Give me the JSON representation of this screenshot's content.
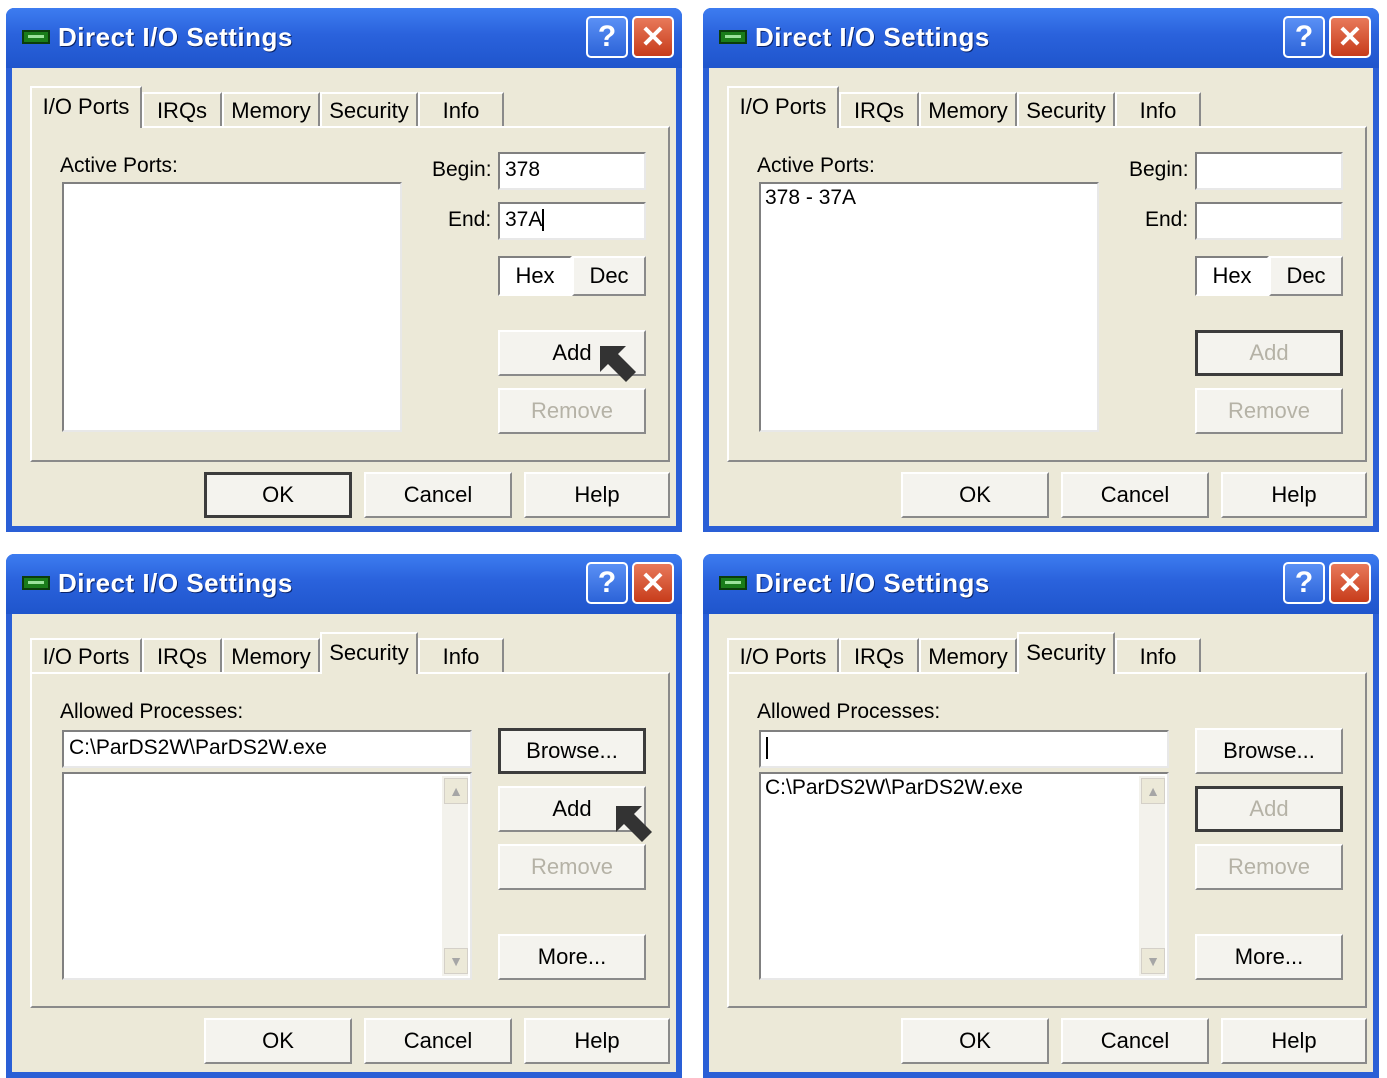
{
  "dialogs": [
    {
      "title": "Direct I/O Settings",
      "tabs": [
        "I/O Ports",
        "IRQs",
        "Memory",
        "Security",
        "Info"
      ],
      "active_tab": "I/O Ports",
      "active_ports_label": "Active Ports:",
      "begin_label": "Begin:",
      "end_label": "End:",
      "begin_value": "378",
      "end_value": "37A",
      "hex_label": "Hex",
      "dec_label": "Dec",
      "add_label": "Add",
      "remove_label": "Remove",
      "ports": [],
      "ok_label": "OK",
      "cancel_label": "Cancel",
      "help_label": "Help"
    },
    {
      "title": "Direct I/O Settings",
      "tabs": [
        "I/O Ports",
        "IRQs",
        "Memory",
        "Security",
        "Info"
      ],
      "active_tab": "I/O Ports",
      "active_ports_label": "Active Ports:",
      "begin_label": "Begin:",
      "end_label": "End:",
      "begin_value": "",
      "end_value": "",
      "hex_label": "Hex",
      "dec_label": "Dec",
      "add_label": "Add",
      "remove_label": "Remove",
      "ports": [
        "378 - 37A"
      ],
      "ok_label": "OK",
      "cancel_label": "Cancel",
      "help_label": "Help"
    },
    {
      "title": "Direct I/O Settings",
      "tabs": [
        "I/O Ports",
        "IRQs",
        "Memory",
        "Security",
        "Info"
      ],
      "active_tab": "Security",
      "allowed_label": "Allowed Processes:",
      "process_value": "C:\\ParDS2W\\ParDS2W.exe",
      "processes": [],
      "browse_label": "Browse...",
      "add_label": "Add",
      "remove_label": "Remove",
      "more_label": "More...",
      "ok_label": "OK",
      "cancel_label": "Cancel",
      "help_label": "Help"
    },
    {
      "title": "Direct I/O Settings",
      "tabs": [
        "I/O Ports",
        "IRQs",
        "Memory",
        "Security",
        "Info"
      ],
      "active_tab": "Security",
      "allowed_label": "Allowed Processes:",
      "process_value": "",
      "processes": [
        "C:\\ParDS2W\\ParDS2W.exe"
      ],
      "browse_label": "Browse...",
      "add_label": "Add",
      "remove_label": "Remove",
      "more_label": "More...",
      "ok_label": "OK",
      "cancel_label": "Cancel",
      "help_label": "Help"
    }
  ],
  "icons": {
    "help": "question-mark",
    "close": "x-mark",
    "pointer": "arrow-cursor",
    "app": "card-icon"
  },
  "colors": {
    "titlebar": "#2a62dc",
    "close": "#c73c1b",
    "face": "#ece9d8"
  }
}
